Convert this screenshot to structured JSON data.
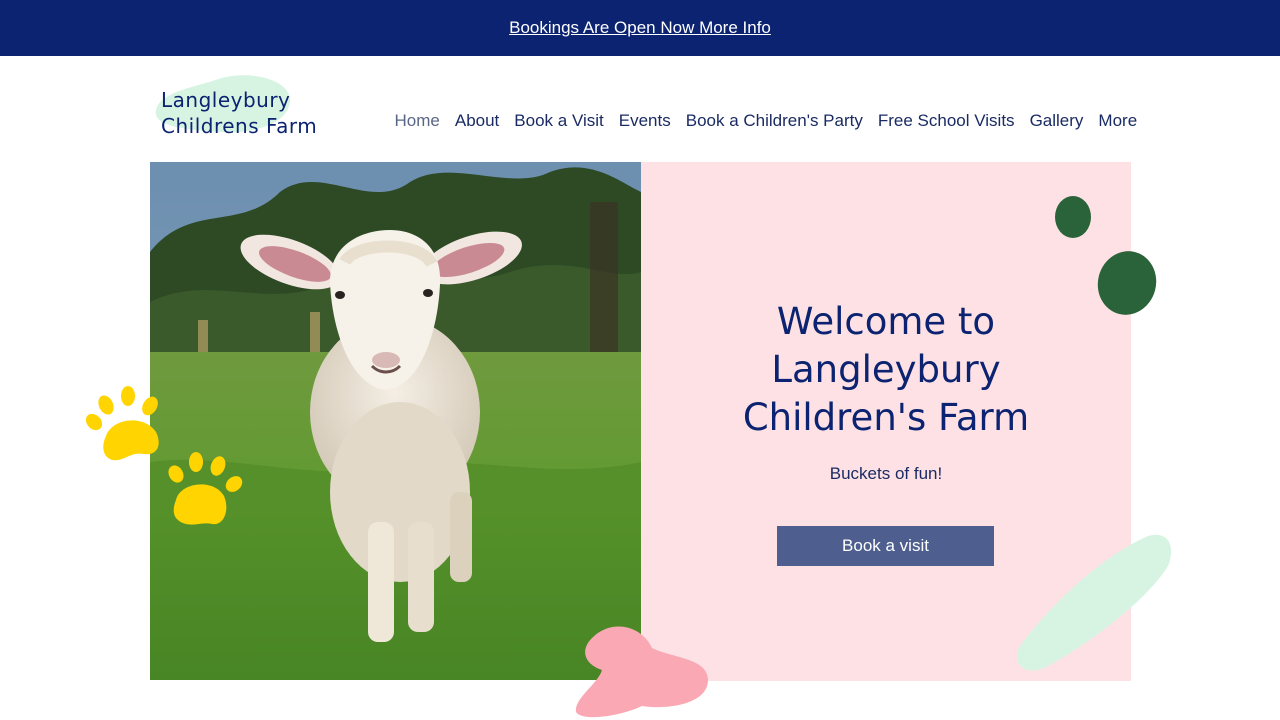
{
  "announcement": {
    "link_text": "Bookings Are Open Now More Info"
  },
  "logo": {
    "line1": "Langleybury",
    "line2": "Childrens Farm"
  },
  "nav": {
    "items": [
      {
        "label": "Home"
      },
      {
        "label": "About"
      },
      {
        "label": "Book a Visit"
      },
      {
        "label": "Events"
      },
      {
        "label": "Book a Children's Party"
      },
      {
        "label": "Free School Visits"
      },
      {
        "label": "Gallery"
      },
      {
        "label": "More"
      }
    ],
    "active": "Home"
  },
  "hero": {
    "title_lines": [
      "Welcome to",
      "Langleybury",
      "Children's Farm"
    ],
    "subtitle": "Buckets of fun!",
    "cta_label": "Book a visit"
  },
  "colors": {
    "banner": "#0b2370",
    "panel": "#fde1e4",
    "button": "#4d5e8f",
    "paw": "#ffd400",
    "green_dot": "#2a6339",
    "mint_stroke": "#d7f4e3",
    "pink_stroke": "#f9a8b4"
  }
}
